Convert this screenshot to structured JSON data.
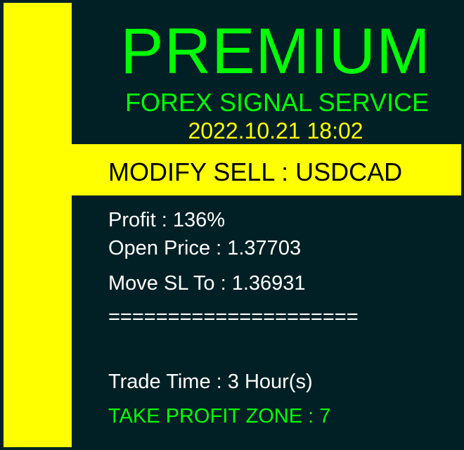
{
  "header": {
    "brand": "PREMIUM",
    "subtitle": "FOREX SIGNAL SERVICE",
    "timestamp": "2022.10.21 18:02"
  },
  "signal": {
    "action": "MODIFY SELL : USDCAD",
    "profit": "Profit : 136%",
    "open_price": "Open Price : 1.37703",
    "move_sl": "Move SL To : 1.36931",
    "separator": "=====================",
    "trade_time": "Trade Time : 3 Hour(s)",
    "take_profit_zone": "TAKE PROFIT ZONE : 7"
  },
  "colors": {
    "background": "#012025",
    "accent_yellow": "#ffff00",
    "accent_green": "#00ff00",
    "text_white": "#ffffff"
  }
}
